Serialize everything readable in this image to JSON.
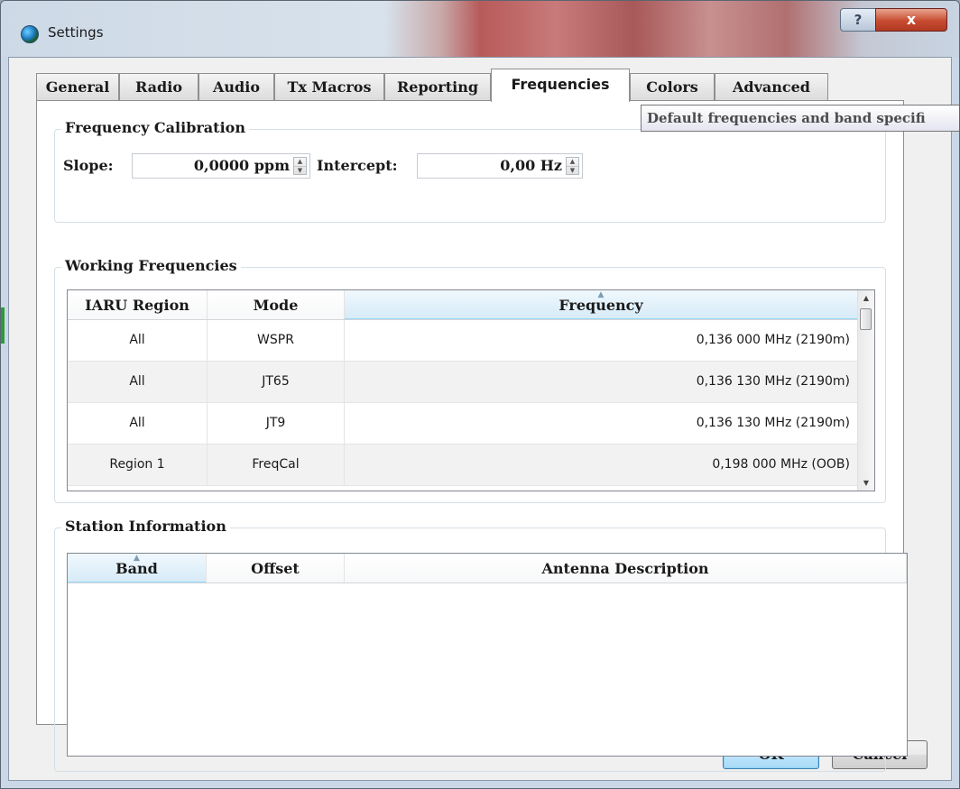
{
  "window": {
    "title": "Settings",
    "help_label": "?",
    "close_label": "x"
  },
  "tabs": [
    {
      "label": "General",
      "active": false
    },
    {
      "label": "Radio",
      "active": false
    },
    {
      "label": "Audio",
      "active": false
    },
    {
      "label": "Tx Macros",
      "active": false
    },
    {
      "label": "Reporting",
      "active": false
    },
    {
      "label": "Frequencies",
      "active": true
    },
    {
      "label": "Colors",
      "active": false
    },
    {
      "label": "Advanced",
      "active": false
    }
  ],
  "tooltip": "Default frequencies and band specifi",
  "calibration": {
    "title": "Frequency Calibration",
    "slope_label": "Slope:",
    "slope_value": "0,0000 ppm",
    "intercept_label": "Intercept:",
    "intercept_value": "0,00 Hz"
  },
  "working": {
    "title": "Working Frequencies",
    "columns": [
      "IARU Region",
      "Mode",
      "Frequency"
    ],
    "rows": [
      {
        "region": "All",
        "mode": "WSPR",
        "frequency": "0,136 000 MHz (2190m)"
      },
      {
        "region": "All",
        "mode": "JT65",
        "frequency": "0,136 130 MHz (2190m)"
      },
      {
        "region": "All",
        "mode": "JT9",
        "frequency": "0,136 130 MHz (2190m)"
      },
      {
        "region": "Region 1",
        "mode": "FreqCal",
        "frequency": "0,198 000 MHz (OOB)"
      }
    ]
  },
  "station": {
    "title": "Station Information",
    "columns": [
      "Band",
      "Offset",
      "Antenna Description"
    ]
  },
  "buttons": {
    "ok": "OK",
    "cancel": "Cancel"
  },
  "colors": {
    "close_button": "#c74b30",
    "sorted_header": "#d7ebf8",
    "default_button_border": "#3c7fb1"
  }
}
